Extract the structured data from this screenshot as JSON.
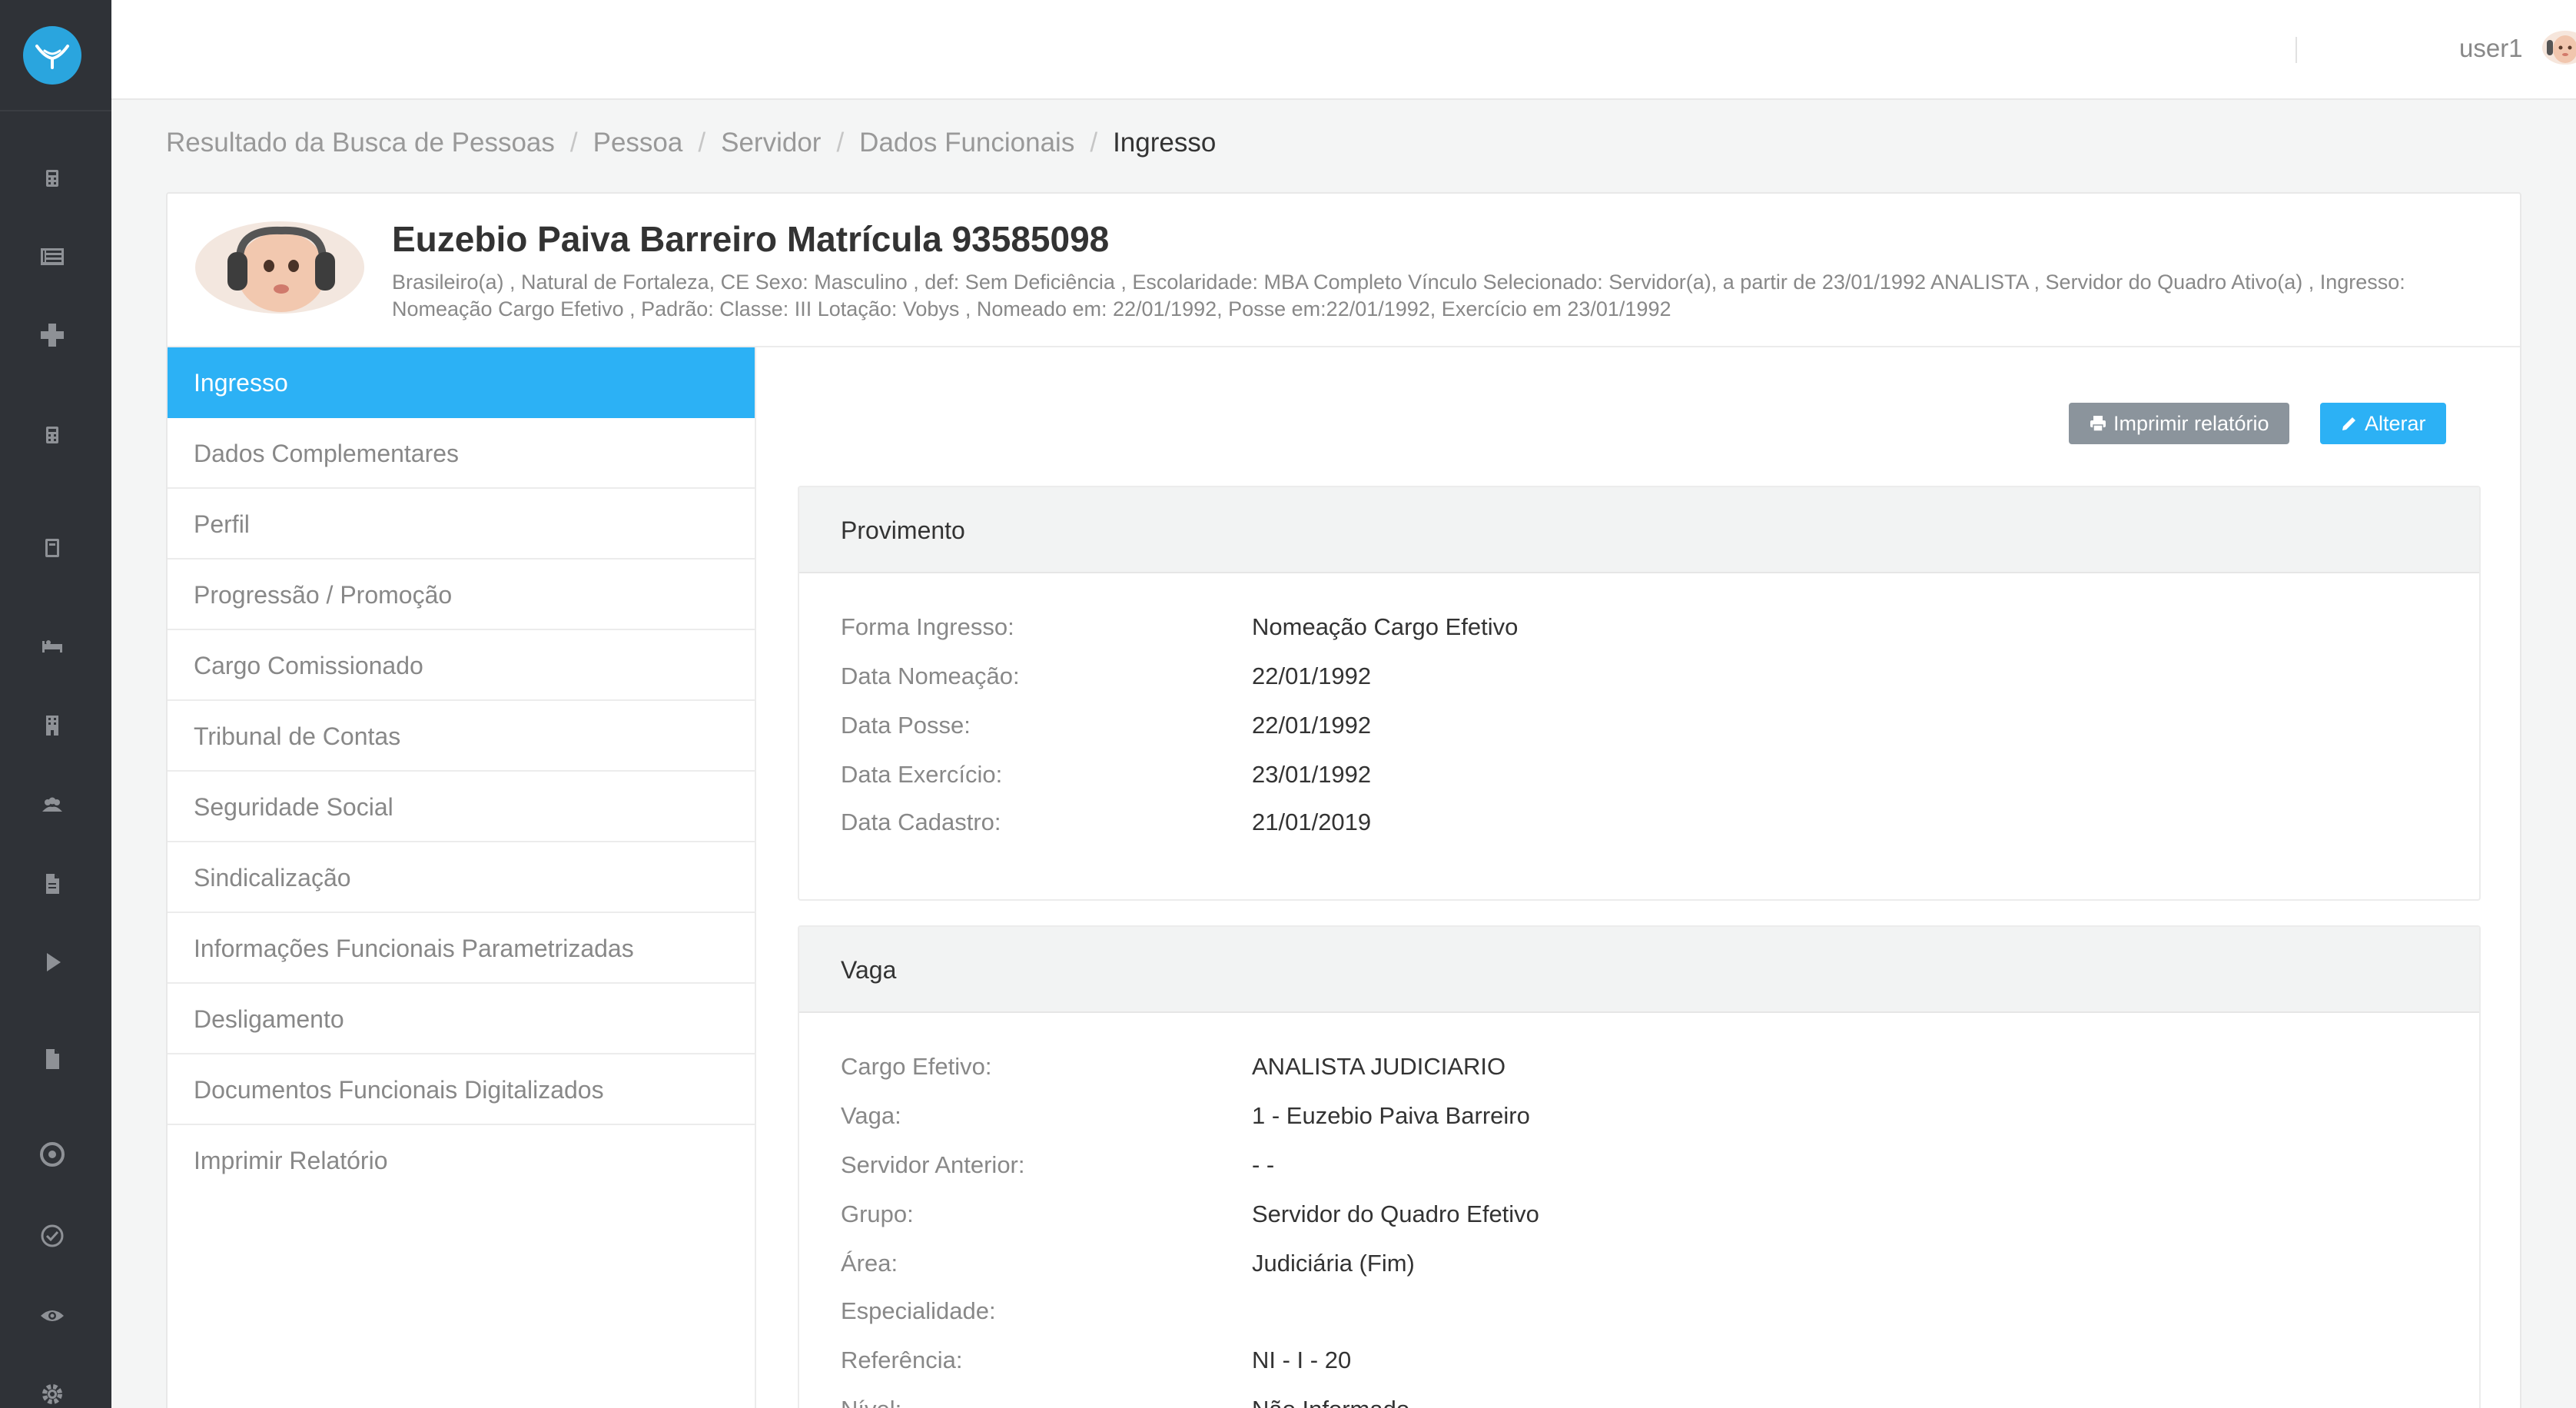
{
  "header": {
    "user_name": "user1"
  },
  "breadcrumb": [
    "Resultado da Busca de Pessoas",
    "Pessoa",
    "Servidor",
    "Dados Funcionais",
    "Ingresso"
  ],
  "person": {
    "name": "Euzebio Paiva Barreiro Matrícula 93585098",
    "description": "Brasileiro(a) , Natural de Fortaleza, CE Sexo: Masculino , def: Sem Deficiência , Escolaridade: MBA Completo Vínculo Selecionado: Servidor(a), a partir de 23/01/1992 ANALISTA , Servidor do Quadro Ativo(a) , Ingresso: Nomeação Cargo Efetivo , Padrão: Classe: III Lotação: Vobys , Nomeado em: 22/01/1992, Posse em:22/01/1992, Exercício em 23/01/1992"
  },
  "menu": [
    "Ingresso",
    "Dados Complementares",
    "Perfil",
    "Progressão / Promoção",
    "Cargo Comissionado",
    "Tribunal de Contas",
    "Seguridade Social",
    "Sindicalização",
    "Informações Funcionais Parametrizadas",
    "Desligamento",
    "Documentos Funcionais Digitalizados",
    "Imprimir Relatório"
  ],
  "actions": {
    "print_label": "Imprimir relatório",
    "alter_label": "Alterar"
  },
  "provimento": {
    "title": "Provimento",
    "rows": [
      {
        "label": "Forma Ingresso:",
        "value": "Nomeação Cargo Efetivo"
      },
      {
        "label": "Data Nomeação:",
        "value": "22/01/1992"
      },
      {
        "label": "Data Posse:",
        "value": "22/01/1992"
      },
      {
        "label": "Data Exercício:",
        "value": "23/01/1992"
      },
      {
        "label": "Data Cadastro:",
        "value": "21/01/2019"
      }
    ]
  },
  "vaga": {
    "title": "Vaga",
    "rows": [
      {
        "label": "Cargo Efetivo:",
        "value": "ANALISTA JUDICIARIO"
      },
      {
        "label": "Vaga:",
        "value": "1 - Euzebio Paiva Barreiro"
      },
      {
        "label": "Servidor Anterior:",
        "value": "- -"
      },
      {
        "label": "Grupo:",
        "value": "Servidor do Quadro Efetivo"
      },
      {
        "label": "Área:",
        "value": "Judiciária (Fim)"
      },
      {
        "label": "Especialidade:",
        "value": ""
      },
      {
        "label": "Referência:",
        "value": "NI - I - 20"
      },
      {
        "label": "Nível:",
        "value": "Não Informado"
      }
    ]
  },
  "colors": {
    "rail": "#2f3237",
    "accent": "#2cb1f5",
    "logo": "#2aa5de",
    "print_button": "#8b949c"
  },
  "rail_icons": [
    "calculator-icon",
    "table-icon",
    "plus-icon",
    "calculator-icon",
    "calculator-icon",
    "bed-icon",
    "building-icon",
    "users-icon",
    "file-icon",
    "play-icon",
    "file-icon",
    "target-icon",
    "check-circle-icon",
    "eye-icon",
    "gear-icon"
  ]
}
